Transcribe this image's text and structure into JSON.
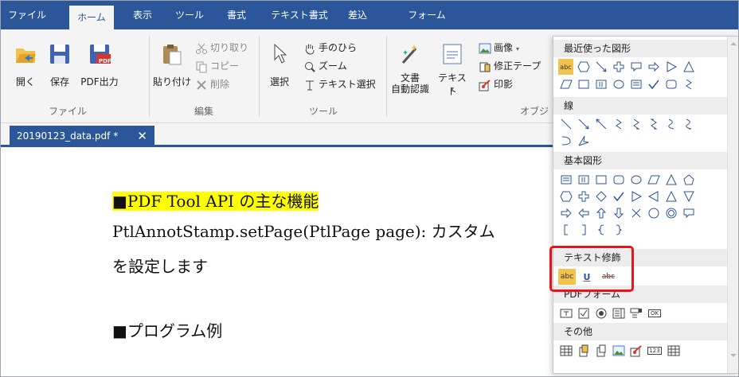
{
  "menu": {
    "tabs": [
      "ファイル",
      "ホーム",
      "表示",
      "ツール",
      "書式",
      "テキスト書式",
      "差込",
      "フォーム"
    ],
    "active": "ホーム"
  },
  "ribbon": {
    "file_group": {
      "label": "ファイル",
      "open": "開く",
      "save": "保存",
      "pdf_out": "PDF出力",
      "pdf_badge": "PDF"
    },
    "edit_group": {
      "label": "編集",
      "paste": "貼り付け",
      "cut": "切り取り",
      "copy": "コピー",
      "delete": "削除"
    },
    "tool_group": {
      "label": "ツール",
      "select": "選択",
      "hand": "手のひら",
      "zoom": "ズーム",
      "text_select": "テキスト選択"
    },
    "object_group": {
      "label": "オブジ",
      "ocr_line1": "文書",
      "ocr_line2": "自動認識",
      "text": "テキスト",
      "image": "画像",
      "correction_tape": "修正テープ",
      "stamp": "印影"
    }
  },
  "document": {
    "tab_title": "20190123_data.pdf *",
    "close_glyph": "✕",
    "heading": "■PDF Tool API の主な機能",
    "line2": "PtlAnnotStamp.setPage(PtlPage page): カスタム",
    "line3": "を設定します",
    "line4": "■プログラム例"
  },
  "shapes_panel": {
    "sections": {
      "recent": "最近使った図形",
      "lines": "線",
      "basic": "基本図形",
      "text_decoration": "テキスト修飾",
      "pdf_form": "PDFフォーム",
      "other": "その他"
    },
    "text_decoration_items": [
      "abc",
      "U",
      "abc"
    ],
    "recent_badge": "abc",
    "form_ok": "OK",
    "other_123": "123"
  },
  "colors": {
    "menubar": "#2b579a",
    "highlight": "#ffff00",
    "callout": "#e8141b"
  }
}
